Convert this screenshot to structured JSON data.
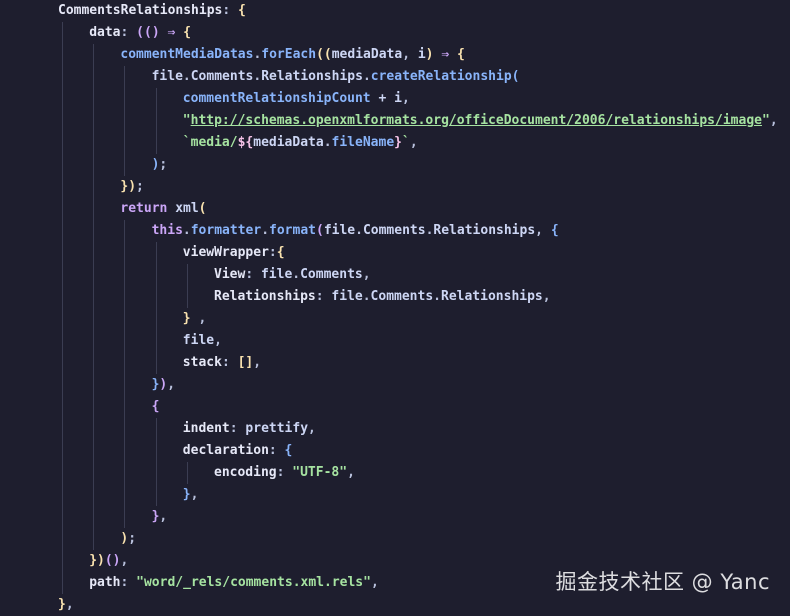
{
  "watermark": "掘金技术社区 @ Yanc",
  "colors": {
    "background": "#1e1e2e",
    "property": "#e6e8f7",
    "function": "#89b4fa",
    "keyword": "#cba6f7",
    "string": "#a6e3a1",
    "brace_yellow": "#f9e2af",
    "brace_purple": "#cba6f7",
    "brace_blue": "#89b4fa"
  },
  "code_lines": [
    [
      {
        "t": "CommentsRelationships",
        "c": "prop"
      },
      {
        "t": ": ",
        "c": "punct"
      },
      {
        "t": "{",
        "c": "brace-y"
      }
    ],
    [
      {
        "t": "data",
        "c": "prop"
      },
      {
        "t": ": ",
        "c": "punct"
      },
      {
        "t": "((",
        "c": "brace-p"
      },
      {
        "t": ") ",
        "c": "brace-p"
      },
      {
        "t": "⇒ ",
        "c": "kw"
      },
      {
        "t": "{",
        "c": "brace-y"
      }
    ],
    [
      {
        "t": "commentMediaDatas",
        "c": "func"
      },
      {
        "t": ".",
        "c": "punct"
      },
      {
        "t": "forEach",
        "c": "func"
      },
      {
        "t": "((",
        "c": "brace-y"
      },
      {
        "t": "mediaData",
        "c": "var"
      },
      {
        "t": ", ",
        "c": "punct"
      },
      {
        "t": "i",
        "c": "var"
      },
      {
        "t": ") ",
        "c": "brace-y"
      },
      {
        "t": "⇒ ",
        "c": "kw"
      },
      {
        "t": "{",
        "c": "brace-y"
      }
    ],
    [
      {
        "t": "file",
        "c": "var"
      },
      {
        "t": ".",
        "c": "punct"
      },
      {
        "t": "Comments",
        "c": "var"
      },
      {
        "t": ".",
        "c": "punct"
      },
      {
        "t": "Relationships",
        "c": "var"
      },
      {
        "t": ".",
        "c": "punct"
      },
      {
        "t": "createRelationship",
        "c": "func"
      },
      {
        "t": "(",
        "c": "brace-b"
      }
    ],
    [
      {
        "t": "commentRelationshipCount",
        "c": "func"
      },
      {
        "t": " + ",
        "c": "op"
      },
      {
        "t": "i",
        "c": "var"
      },
      {
        "t": ",",
        "c": "punct"
      }
    ],
    [
      {
        "t": "\"",
        "c": "str"
      },
      {
        "t": "http://schemas.openxmlformats.org/officeDocument/2006/relationships/image",
        "c": "url"
      },
      {
        "t": "\"",
        "c": "str"
      },
      {
        "t": ",",
        "c": "punct"
      }
    ],
    [
      {
        "t": "`media/",
        "c": "str"
      },
      {
        "t": "${",
        "c": "tpl"
      },
      {
        "t": "mediaData",
        "c": "var"
      },
      {
        "t": ".",
        "c": "punct"
      },
      {
        "t": "fileName",
        "c": "func"
      },
      {
        "t": "}",
        "c": "tpl"
      },
      {
        "t": "`",
        "c": "str"
      },
      {
        "t": ",",
        "c": "punct"
      }
    ],
    [
      {
        "t": ")",
        "c": "brace-b"
      },
      {
        "t": ";",
        "c": "punct"
      }
    ],
    [
      {
        "t": "})",
        "c": "brace-y"
      },
      {
        "t": ";",
        "c": "punct"
      }
    ],
    [
      {
        "t": "return ",
        "c": "kw"
      },
      {
        "t": "xml",
        "c": "var"
      },
      {
        "t": "(",
        "c": "brace-y"
      }
    ],
    [
      {
        "t": "this",
        "c": "kw"
      },
      {
        "t": ".",
        "c": "punct"
      },
      {
        "t": "formatter",
        "c": "func"
      },
      {
        "t": ".",
        "c": "punct"
      },
      {
        "t": "format",
        "c": "func"
      },
      {
        "t": "(",
        "c": "brace-p"
      },
      {
        "t": "file",
        "c": "var"
      },
      {
        "t": ".",
        "c": "punct"
      },
      {
        "t": "Comments",
        "c": "var"
      },
      {
        "t": ".",
        "c": "punct"
      },
      {
        "t": "Relationships",
        "c": "var"
      },
      {
        "t": ", ",
        "c": "punct"
      },
      {
        "t": "{",
        "c": "brace-b"
      }
    ],
    [
      {
        "t": "viewWrapper",
        "c": "prop"
      },
      {
        "t": ":",
        "c": "punct"
      },
      {
        "t": "{",
        "c": "brace-y"
      }
    ],
    [
      {
        "t": "View",
        "c": "prop"
      },
      {
        "t": ": ",
        "c": "punct"
      },
      {
        "t": "file",
        "c": "var"
      },
      {
        "t": ".",
        "c": "punct"
      },
      {
        "t": "Comments",
        "c": "var"
      },
      {
        "t": ",",
        "c": "punct"
      }
    ],
    [
      {
        "t": "Relationships",
        "c": "prop"
      },
      {
        "t": ": ",
        "c": "punct"
      },
      {
        "t": "file",
        "c": "var"
      },
      {
        "t": ".",
        "c": "punct"
      },
      {
        "t": "Comments",
        "c": "var"
      },
      {
        "t": ".",
        "c": "punct"
      },
      {
        "t": "Relationships",
        "c": "var"
      },
      {
        "t": ",",
        "c": "punct"
      }
    ],
    [
      {
        "t": "}",
        "c": "brace-y"
      },
      {
        "t": " ,",
        "c": "punct"
      }
    ],
    [
      {
        "t": "file",
        "c": "var"
      },
      {
        "t": ",",
        "c": "punct"
      }
    ],
    [
      {
        "t": "stack",
        "c": "prop"
      },
      {
        "t": ": ",
        "c": "punct"
      },
      {
        "t": "[]",
        "c": "brace-y"
      },
      {
        "t": ",",
        "c": "punct"
      }
    ],
    [
      {
        "t": "}",
        "c": "brace-b"
      },
      {
        "t": ")",
        "c": "brace-p"
      },
      {
        "t": ",",
        "c": "punct"
      }
    ],
    [
      {
        "t": "{",
        "c": "brace-p"
      }
    ],
    [
      {
        "t": "indent",
        "c": "prop"
      },
      {
        "t": ": ",
        "c": "punct"
      },
      {
        "t": "prettify",
        "c": "var"
      },
      {
        "t": ",",
        "c": "punct"
      }
    ],
    [
      {
        "t": "declaration",
        "c": "prop"
      },
      {
        "t": ": ",
        "c": "punct"
      },
      {
        "t": "{",
        "c": "brace-b"
      }
    ],
    [
      {
        "t": "encoding",
        "c": "prop"
      },
      {
        "t": ": ",
        "c": "punct"
      },
      {
        "t": "\"UTF-8\"",
        "c": "str"
      },
      {
        "t": ",",
        "c": "punct"
      }
    ],
    [
      {
        "t": "}",
        "c": "brace-b"
      },
      {
        "t": ",",
        "c": "punct"
      }
    ],
    [
      {
        "t": "}",
        "c": "brace-p"
      },
      {
        "t": ",",
        "c": "punct"
      }
    ],
    [
      {
        "t": ")",
        "c": "brace-y"
      },
      {
        "t": ";",
        "c": "punct"
      }
    ],
    [
      {
        "t": "})",
        "c": "brace-y"
      },
      {
        "t": "()",
        "c": "brace-p"
      },
      {
        "t": ",",
        "c": "punct"
      }
    ],
    [
      {
        "t": "path",
        "c": "prop"
      },
      {
        "t": ": ",
        "c": "punct"
      },
      {
        "t": "\"word/_rels/comments.xml.rels\"",
        "c": "str"
      },
      {
        "t": ",",
        "c": "punct"
      }
    ],
    [
      {
        "t": "}",
        "c": "brace-y"
      },
      {
        "t": ",",
        "c": "punct"
      }
    ]
  ]
}
